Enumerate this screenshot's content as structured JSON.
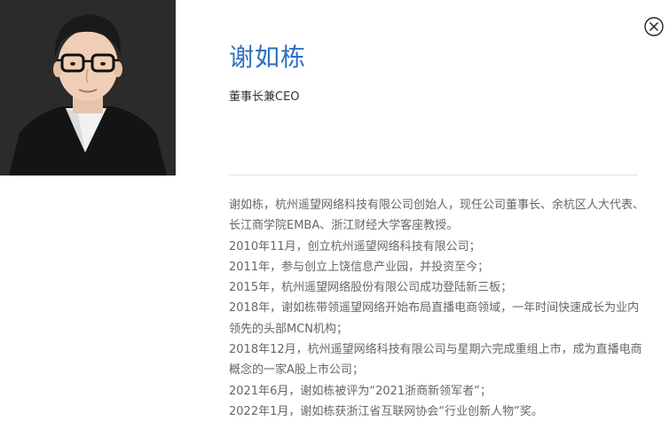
{
  "profile": {
    "name": "谢如栋",
    "title": "董事长兼CEO",
    "photo_icon": "portrait-photo"
  },
  "close_icon": "close-circle-icon",
  "bio": [
    "谢如栋，杭州遥望网络科技有限公司创始人，现任公司董事长、余杭区人大代表、长江商学院EMBA、浙江财经大学客座教授。",
    "2010年11月，创立杭州遥望网络科技有限公司；",
    "2011年，参与创立上饶信息产业园，并投资至今；",
    "2015年，杭州遥望网络股份有限公司成功登陆新三板；",
    "2018年，谢如栋带领遥望网络开始布局直播电商领域，一年时间快速成长为业内领先的头部MCN机构；",
    "2018年12月，杭州遥望网络科技有限公司与星期六完成重组上市，成为直播电商概念的一家A股上市公司；",
    "2021年6月，谢如栋被评为“2021浙商新领军者”；",
    "2022年1月，谢如栋获浙江省互联网协会“行业创新人物”奖。"
  ],
  "colors": {
    "name": "#2f6ec0",
    "body_text": "#666666",
    "portrait_bg": "#2b2b2b"
  }
}
